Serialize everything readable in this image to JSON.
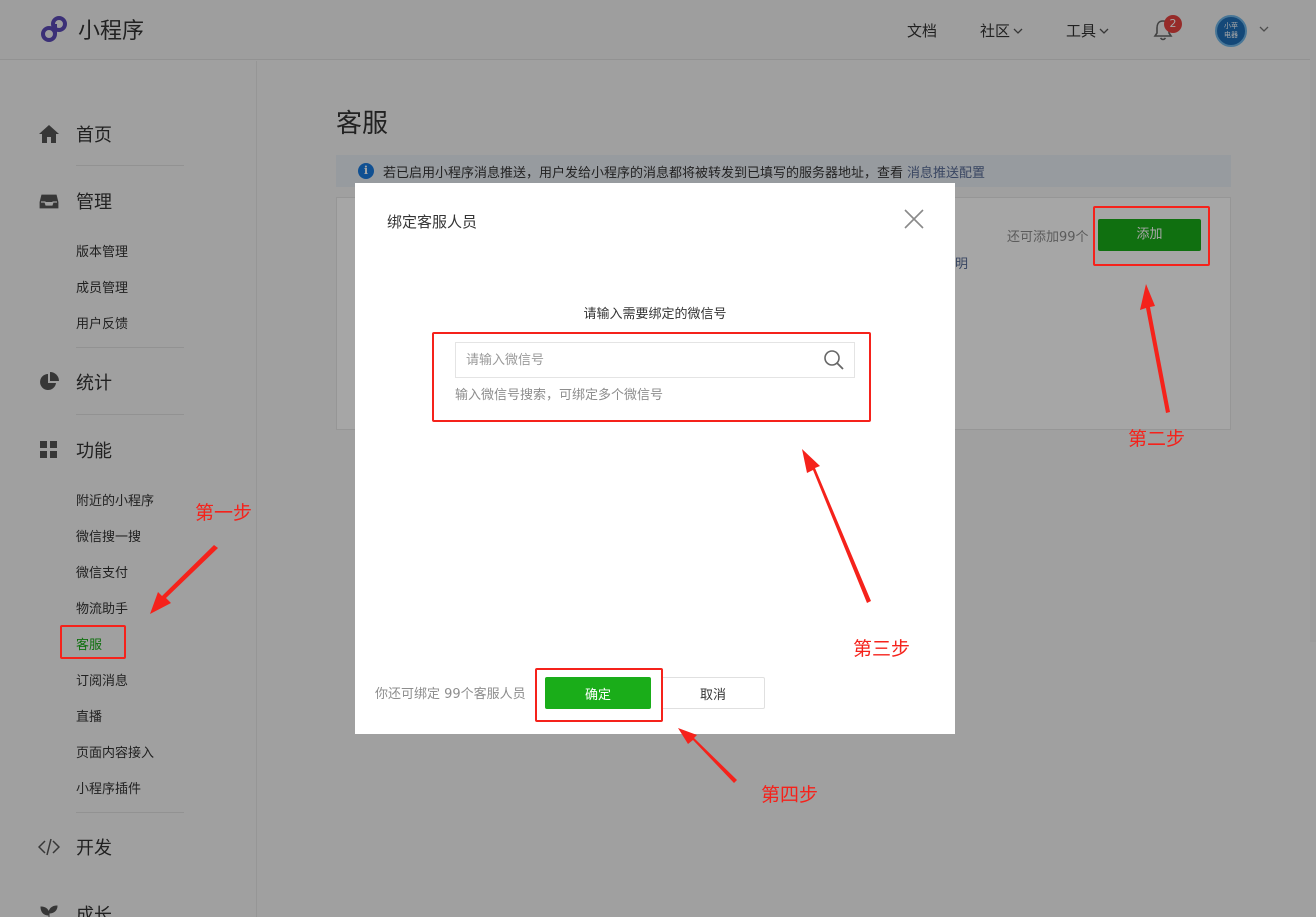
{
  "header": {
    "logo_text": "小程序",
    "nav": {
      "docs": "文档",
      "community": "社区",
      "tools": "工具"
    },
    "notification_count": "2",
    "avatar_text_line1": "小苹",
    "avatar_text_line2": "电器"
  },
  "sidebar": {
    "home": "首页",
    "manage": "管理",
    "manage_items": [
      "版本管理",
      "成员管理",
      "用户反馈"
    ],
    "stats": "统计",
    "features": "功能",
    "feature_items": [
      "附近的小程序",
      "微信搜一搜",
      "微信支付",
      "物流助手",
      "客服",
      "订阅消息",
      "直播",
      "页面内容接入",
      "小程序插件"
    ],
    "dev": "开发",
    "growth": "成长"
  },
  "main": {
    "title": "客服",
    "notice_text": "若已启用小程序消息推送，用户发给小程序的消息都将被转发到已填写的服务器地址，查看",
    "notice_link": "消息推送配置",
    "remain_text": "还可添加99个",
    "add_button": "添加",
    "clipped_text": "明"
  },
  "dialog": {
    "title": "绑定客服人员",
    "field_label": "请输入需要绑定的微信号",
    "search_placeholder": "请输入微信号",
    "hint": "输入微信号搜索，可绑定多个微信号",
    "footer_text": "你还可绑定 99个客服人员",
    "confirm": "确定",
    "cancel": "取消"
  },
  "annotations": {
    "step1": "第一步",
    "step2": "第二步",
    "step3": "第三步",
    "step4": "第四步",
    "color": "#f5221b"
  },
  "colors": {
    "primary_green": "#1aad19",
    "link_blue": "#576b95",
    "notice_bg": "#e9eef5"
  }
}
